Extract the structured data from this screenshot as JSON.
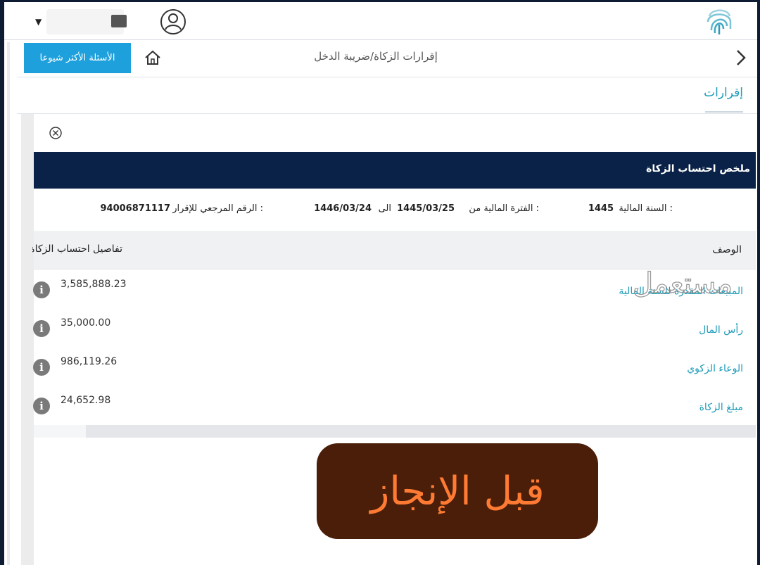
{
  "header": {
    "faq_button": "الأسئلة الأكثر شيوعا",
    "breadcrumb": "إقرارات الزكاة/ضريبة الدخل"
  },
  "section": {
    "title": "إقرارات"
  },
  "summary": {
    "title": "ملخص احتساب الزكاة",
    "fiscal_year_label": "السنة المالية :",
    "fiscal_year": "1445",
    "period_from_label": "الفترة المالية من :",
    "period_from": "1445/03/25",
    "period_to_label": "الى",
    "period_to": "1446/03/24",
    "reference_label": "الرقم المرجعي للإقرار :",
    "reference": "94006871117"
  },
  "table": {
    "columns": {
      "description": "الوصف",
      "details": "تفاصيل احتساب الزكاة"
    },
    "rows": [
      {
        "label": "المبيعات المقدرة للسنة المالية",
        "value": "3,585,888.23"
      },
      {
        "label": "رأس المال",
        "value": "35,000.00"
      },
      {
        "label": "الوعاء الزكوي",
        "value": "986,119.26"
      },
      {
        "label": "مبلغ الزكاة",
        "value": "24,652.98"
      }
    ]
  },
  "watermark": "مستعمل",
  "overlay_badge": "قبل الإنجاز",
  "colors": {
    "header_navy": "#0a2248",
    "accent_blue": "#1ea0dc",
    "link_teal": "#1d9bb9",
    "badge_bg": "#4a1e08",
    "badge_text": "#ff7a33"
  }
}
